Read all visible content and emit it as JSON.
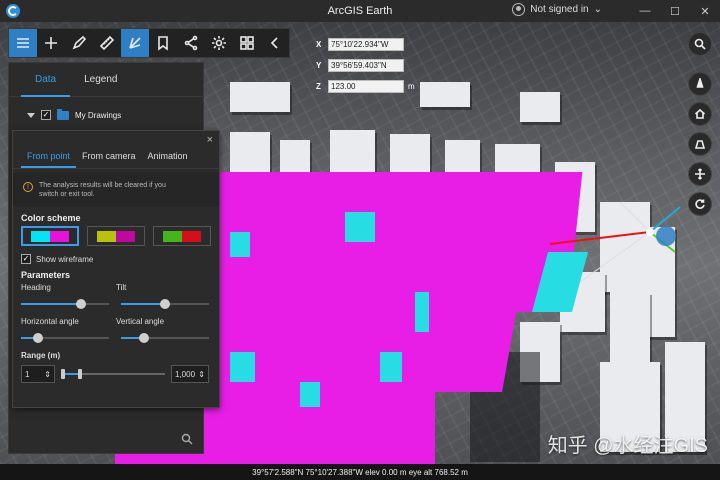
{
  "app": {
    "title": "ArcGIS Earth"
  },
  "titlebar": {
    "user_status": "Not signed in",
    "user_caret": "⌄",
    "window_controls": {
      "minimize": "—",
      "maximize": "☐",
      "close": "✕"
    }
  },
  "toolbar": {
    "tools": [
      {
        "name": "contents-icon",
        "active": false
      },
      {
        "name": "add-icon",
        "active": false
      },
      {
        "name": "draw-icon",
        "active": false
      },
      {
        "name": "measure-icon",
        "active": false
      },
      {
        "name": "viewshed-icon",
        "active": true
      },
      {
        "name": "bookmark-icon",
        "active": false
      },
      {
        "name": "share-icon",
        "active": false
      },
      {
        "name": "settings-icon",
        "active": false
      },
      {
        "name": "grid-icon",
        "active": false
      },
      {
        "name": "collapse-icon",
        "active": false
      }
    ]
  },
  "coordinates": {
    "x_label": "X",
    "x_value": "75°10'22.934\"W",
    "y_label": "Y",
    "y_value": "39°56'59.403\"N",
    "z_label": "Z",
    "z_value": "123.00",
    "z_unit": "m"
  },
  "data_panel": {
    "tabs": [
      {
        "label": "Data",
        "active": true
      },
      {
        "label": "Legend",
        "active": false
      }
    ],
    "layer": {
      "label": "My Drawings",
      "checked": true,
      "check_glyph": "✓"
    }
  },
  "viewshed_panel": {
    "close_glyph": "×",
    "tabs": [
      {
        "label": "From point",
        "active": true
      },
      {
        "label": "From camera",
        "active": false
      },
      {
        "label": "Animation",
        "active": false
      }
    ],
    "notice": "The analysis results will be cleared if you switch or exit tool.",
    "warn_glyph": "!",
    "color_scheme_title": "Color scheme",
    "color_schemes": [
      {
        "colors": [
          "#00e5ef",
          "#e813d8"
        ],
        "selected": true
      },
      {
        "colors": [
          "#b9c10a",
          "#c0089f"
        ],
        "selected": false
      },
      {
        "colors": [
          "#44b51b",
          "#d80d1c"
        ],
        "selected": false
      }
    ],
    "show_wireframe": {
      "label": "Show wireframe",
      "checked": true,
      "check_glyph": "✓"
    },
    "parameters_title": "Parameters",
    "heading": {
      "label": "Heading",
      "value_fraction": 0.68
    },
    "tilt": {
      "label": "Tilt",
      "value_fraction": 0.5
    },
    "horizontal_angle": {
      "label": "Horizontal angle",
      "value_fraction": 0.19
    },
    "vertical_angle": {
      "label": "Vertical angle",
      "value_fraction": 0.26
    },
    "range": {
      "label": "Range (m)",
      "min_value": "1",
      "max_value": "1,000",
      "spin_glyph": "⇕",
      "low_fraction": 0.0,
      "high_fraction": 0.2
    }
  },
  "status_bar": {
    "text": "39°57'2.588\"N 75°10'27.388\"W  elev 0.00 m    eye alt 768.52 m"
  },
  "watermark": {
    "text": "知乎 @水经注GIS"
  },
  "colors": {
    "accent": "#2e7fc6",
    "viewshed_visible": "#27dde3",
    "viewshed_hidden": "#e81ee6"
  }
}
